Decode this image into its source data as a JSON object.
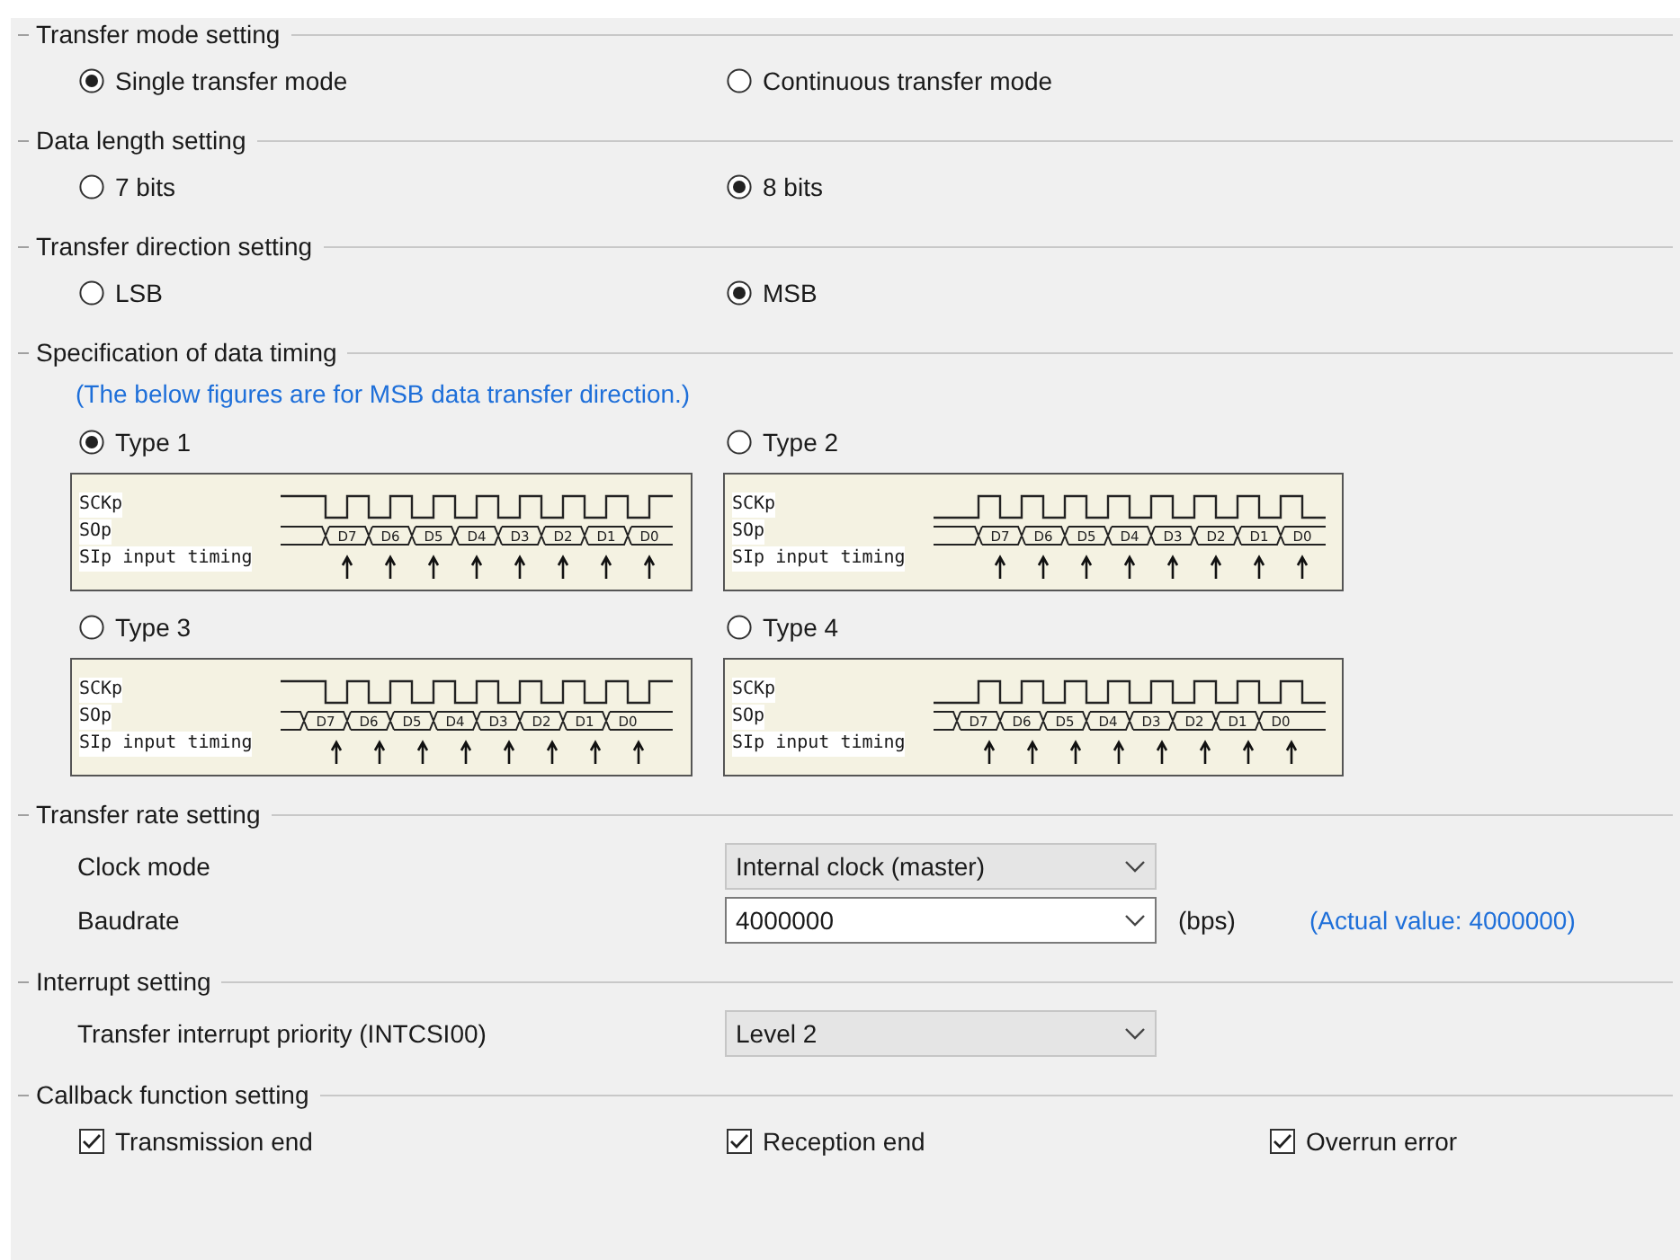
{
  "sections": [
    {
      "title": "Transfer mode setting",
      "kind": "radios",
      "options": [
        {
          "label": "Single transfer mode",
          "selected": true
        },
        {
          "label": "Continuous transfer mode",
          "selected": false
        }
      ]
    },
    {
      "title": "Data length setting",
      "kind": "radios",
      "options": [
        {
          "label": "7 bits",
          "selected": false
        },
        {
          "label": "8 bits",
          "selected": true
        }
      ]
    },
    {
      "title": "Transfer direction setting",
      "kind": "radios",
      "options": [
        {
          "label": "LSB",
          "selected": false
        },
        {
          "label": "MSB",
          "selected": true
        }
      ]
    },
    {
      "title": "Specification of data timing",
      "kind": "timing",
      "note": "(The below figures are for MSB data transfer direction.)",
      "types": [
        {
          "label": "Type 1",
          "selected": true,
          "idle_high": true,
          "early_data": false,
          "signals": [
            "SCKp",
            "SOp",
            "SIp input timing"
          ],
          "bits": [
            "D7",
            "D6",
            "D5",
            "D4",
            "D3",
            "D2",
            "D1",
            "D0"
          ]
        },
        {
          "label": "Type 2",
          "selected": false,
          "idle_high": false,
          "early_data": false,
          "signals": [
            "SCKp",
            "SOp",
            "SIp input timing"
          ],
          "bits": [
            "D7",
            "D6",
            "D5",
            "D4",
            "D3",
            "D2",
            "D1",
            "D0"
          ]
        },
        {
          "label": "Type 3",
          "selected": false,
          "idle_high": true,
          "early_data": true,
          "signals": [
            "SCKp",
            "SOp",
            "SIp input timing"
          ],
          "bits": [
            "D7",
            "D6",
            "D5",
            "D4",
            "D3",
            "D2",
            "D1",
            "D0"
          ]
        },
        {
          "label": "Type 4",
          "selected": false,
          "idle_high": false,
          "early_data": true,
          "signals": [
            "SCKp",
            "SOp",
            "SIp input timing"
          ],
          "bits": [
            "D7",
            "D6",
            "D5",
            "D4",
            "D3",
            "D2",
            "D1",
            "D0"
          ]
        }
      ]
    },
    {
      "title": "Transfer rate setting",
      "kind": "fields",
      "fields": [
        {
          "label": "Clock mode",
          "kind": "select",
          "value": "Internal clock (master)"
        },
        {
          "label": "Baudrate",
          "kind": "combo",
          "value": "4000000",
          "unit": "(bps)",
          "note": "(Actual value: 4000000)"
        }
      ]
    },
    {
      "title": "Interrupt setting",
      "kind": "fields",
      "fields": [
        {
          "label": "Transfer interrupt priority (INTCSI00)",
          "kind": "select",
          "value": "Level 2"
        }
      ]
    },
    {
      "title": "Callback function setting",
      "kind": "checks",
      "options": [
        {
          "label": "Transmission end",
          "checked": true
        },
        {
          "label": "Reception end",
          "checked": true
        },
        {
          "label": "Overrun error",
          "checked": true
        }
      ]
    }
  ]
}
